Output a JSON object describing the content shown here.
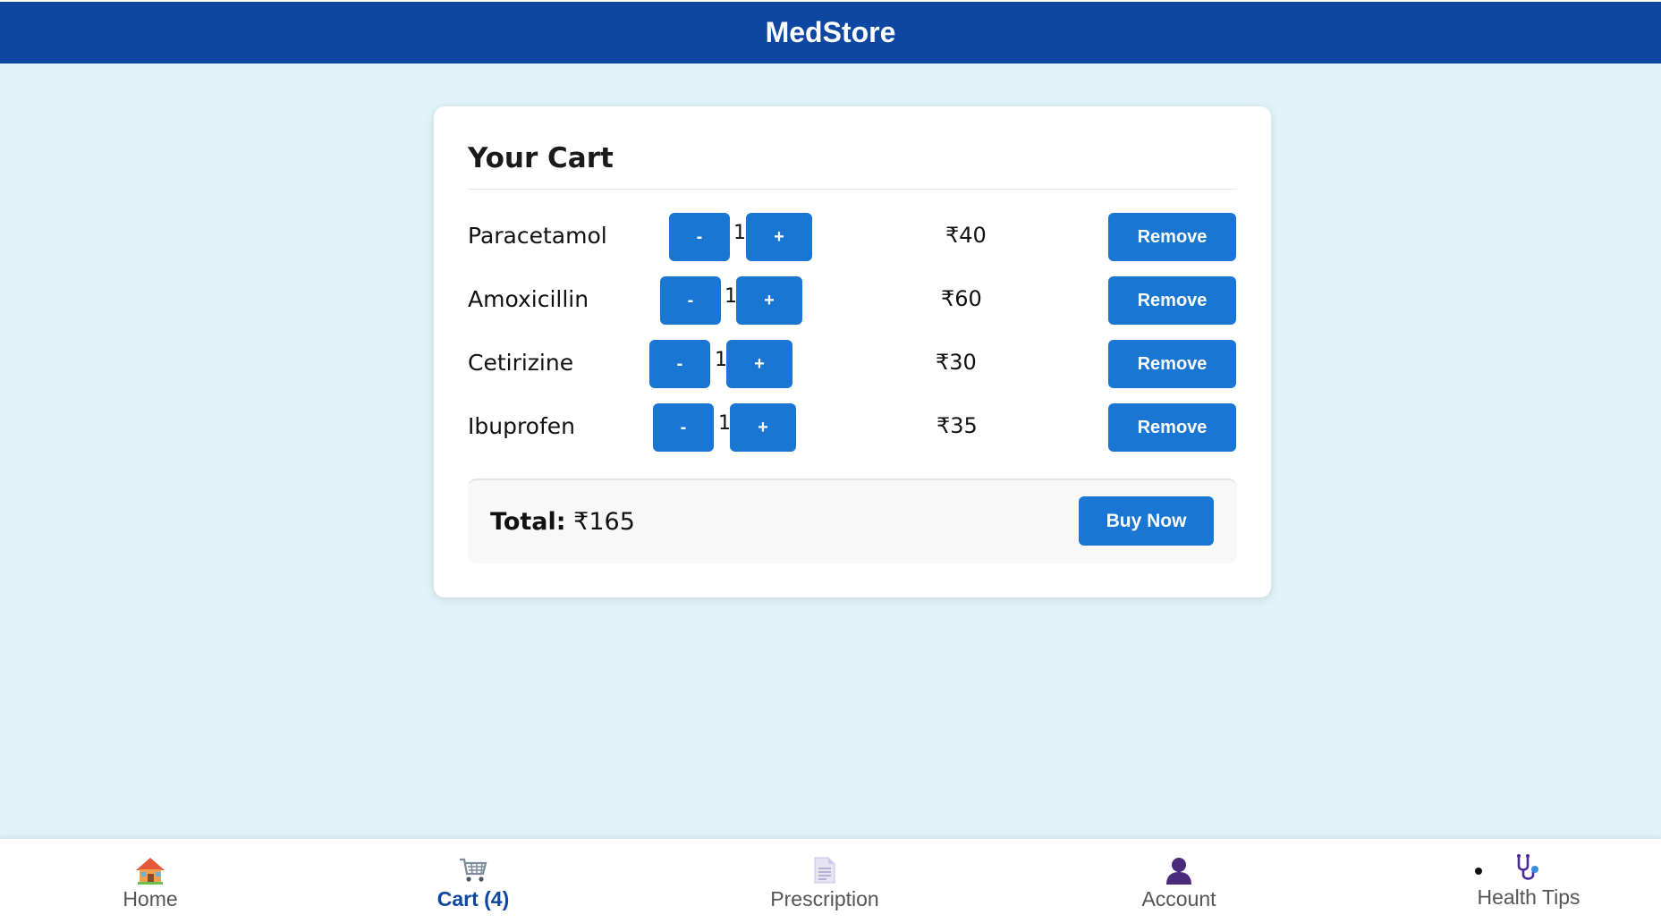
{
  "header": {
    "title": "MedStore"
  },
  "cart": {
    "heading": "Your Cart",
    "items": [
      {
        "name": "Paracetamol",
        "minus_label": "-",
        "quantity": "1",
        "plus_label": "+",
        "price": "₹40",
        "remove_label": "Remove"
      },
      {
        "name": "Amoxicillin",
        "minus_label": "-",
        "quantity": "1",
        "plus_label": "+",
        "price": "₹60",
        "remove_label": "Remove"
      },
      {
        "name": "Cetirizine",
        "minus_label": "-",
        "quantity": "1",
        "plus_label": "+",
        "price": "₹30",
        "remove_label": "Remove"
      },
      {
        "name": "Ibuprofen",
        "minus_label": "-",
        "quantity": "1",
        "plus_label": "+",
        "price": "₹35",
        "remove_label": "Remove"
      }
    ],
    "total_label": "Total:",
    "total_value": "₹165",
    "buy_label": "Buy Now"
  },
  "nav": {
    "items": [
      {
        "label": "Home",
        "icon": "house-icon",
        "active": false
      },
      {
        "label": "Cart (4)",
        "icon": "cart-icon",
        "active": true
      },
      {
        "label": "Prescription",
        "icon": "document-icon",
        "active": false
      },
      {
        "label": "Account",
        "icon": "person-icon",
        "active": false
      },
      {
        "label": "Health Tips",
        "icon": "stethoscope-icon",
        "active": false
      }
    ]
  },
  "colors": {
    "header_bg": "#0d47a1",
    "button_bg": "#1976d2",
    "page_bg": "#e0f3f9",
    "nav_active": "#0d47a1"
  }
}
